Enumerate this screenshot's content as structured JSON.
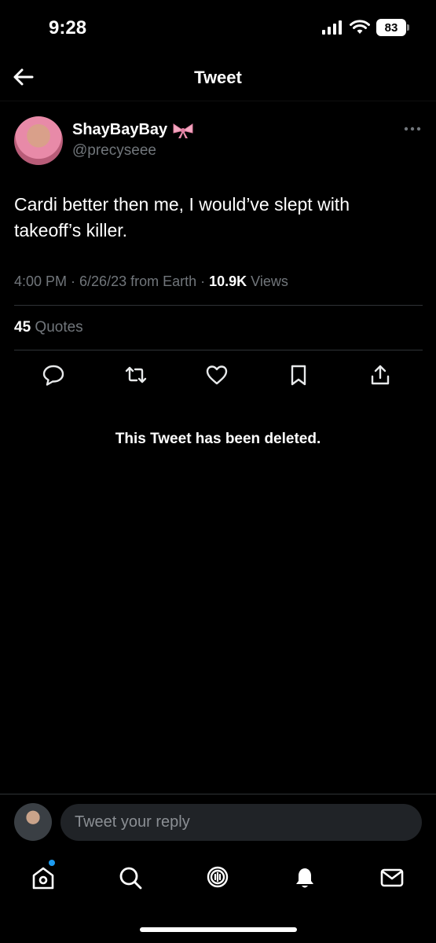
{
  "status_bar": {
    "time": "9:28",
    "battery": "83"
  },
  "header": {
    "title": "Tweet"
  },
  "tweet": {
    "author_name": "ShayBayBay",
    "author_handle": "@precyseee",
    "text": "Cardi better then me, I would’ve slept with takeoff’s killer.",
    "timestamp": "4:00 PM · 6/26/23 from Earth · ",
    "views_count": "10.9K",
    "views_label": " Views",
    "quotes_count": "45",
    "quotes_label": " Quotes"
  },
  "actions": [
    "reply-icon",
    "retweet-icon",
    "like-icon",
    "bookmark-icon",
    "share-icon"
  ],
  "deleted_notice": "This Tweet has been deleted.",
  "reply": {
    "placeholder": "Tweet your reply"
  },
  "nav": [
    "home-icon",
    "search-icon",
    "spaces-icon",
    "notifications-icon",
    "messages-icon"
  ],
  "colors": {
    "background": "#000000",
    "accent": "#1d9bf0",
    "muted": "#71767b"
  }
}
